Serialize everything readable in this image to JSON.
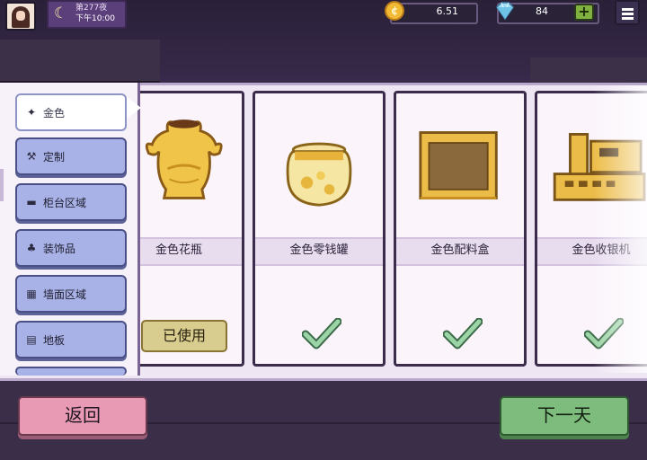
{
  "hud": {
    "day": "第277夜",
    "time": "下午10:00",
    "coins": "6.51",
    "gems": "84",
    "add_gems": "+"
  },
  "categories": [
    {
      "label": "金色",
      "icon": "sparkle-icon",
      "active": true
    },
    {
      "label": "定制",
      "icon": "hammer-icon",
      "active": false
    },
    {
      "label": "柜台区域",
      "icon": "counter-icon",
      "active": false
    },
    {
      "label": "装饰品",
      "icon": "plant-icon",
      "active": false
    },
    {
      "label": "墙面区域",
      "icon": "wall-icon",
      "active": false
    },
    {
      "label": "地板",
      "icon": "floor-icon",
      "active": false
    }
  ],
  "items": [
    {
      "name": "金色花瓶",
      "status": "used",
      "status_label": "已使用"
    },
    {
      "name": "金色零钱罐",
      "status": "owned"
    },
    {
      "name": "金色配料盒",
      "status": "owned"
    },
    {
      "name": "金色收银机",
      "status": "owned"
    }
  ],
  "buttons": {
    "back": "返回",
    "next_day": "下一天"
  },
  "colors": {
    "gold": "#e8b93a",
    "check": "#7fbf8e",
    "back_button": "#e89ab4",
    "next_button": "#7ebc7e"
  }
}
